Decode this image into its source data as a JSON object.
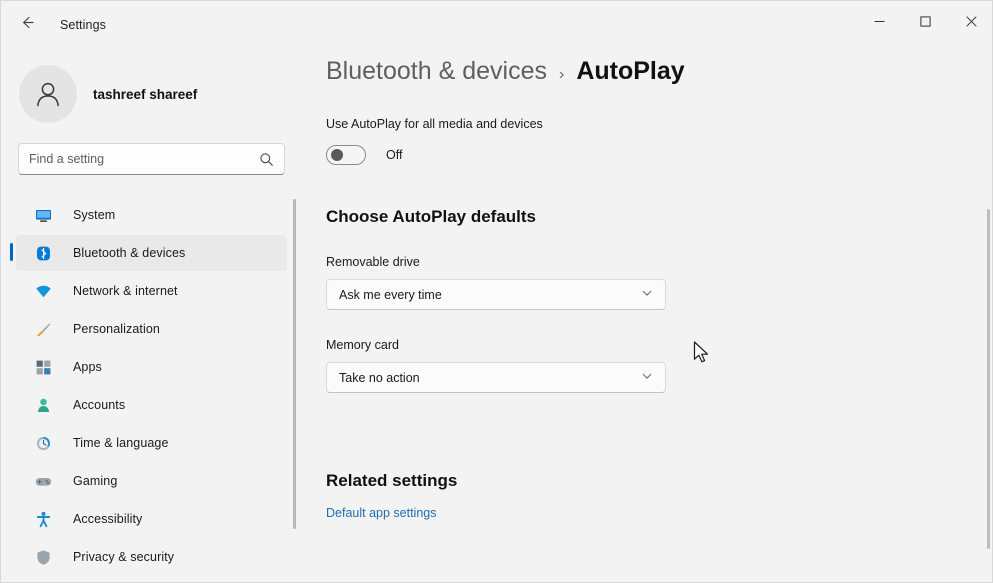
{
  "window": {
    "title": "Settings",
    "back_icon": "back-arrow-icon",
    "controls": {
      "minimize": "minimize-icon",
      "maximize": "maximize-icon",
      "close": "close-icon"
    }
  },
  "sidebar": {
    "profile": {
      "name": "tashreef shareef",
      "avatar_icon": "person-avatar-icon"
    },
    "search": {
      "placeholder": "Find a setting",
      "value": "",
      "icon": "search-icon"
    },
    "items": [
      {
        "label": "System",
        "icon": "monitor-icon",
        "selected": false
      },
      {
        "label": "Bluetooth & devices",
        "icon": "bluetooth-icon",
        "selected": true
      },
      {
        "label": "Network & internet",
        "icon": "wifi-icon",
        "selected": false
      },
      {
        "label": "Personalization",
        "icon": "paintbrush-icon",
        "selected": false
      },
      {
        "label": "Apps",
        "icon": "apps-grid-icon",
        "selected": false
      },
      {
        "label": "Accounts",
        "icon": "account-person-icon",
        "selected": false
      },
      {
        "label": "Time & language",
        "icon": "clock-icon",
        "selected": false
      },
      {
        "label": "Gaming",
        "icon": "gamepad-icon",
        "selected": false
      },
      {
        "label": "Accessibility",
        "icon": "accessibility-icon",
        "selected": false
      },
      {
        "label": "Privacy & security",
        "icon": "shield-lock-icon",
        "selected": false
      }
    ]
  },
  "content": {
    "breadcrumb": {
      "parent": "Bluetooth & devices",
      "separator": "›",
      "current": "AutoPlay"
    },
    "master_toggle": {
      "label": "Use AutoPlay for all media and devices",
      "state_text": "Off",
      "checked": false
    },
    "defaults_section": {
      "title": "Choose AutoPlay defaults",
      "fields": [
        {
          "label": "Removable drive",
          "value": "Ask me every time",
          "chevron": "chevron-down-icon"
        },
        {
          "label": "Memory card",
          "value": "Take no action",
          "chevron": "chevron-down-icon"
        }
      ]
    },
    "related": {
      "title": "Related settings",
      "link": "Default app settings"
    }
  },
  "colors": {
    "accent": "#0067c0",
    "background": "#f3f3f3",
    "link": "#1f6fb0",
    "selected_bg": "#e9e9e9"
  }
}
